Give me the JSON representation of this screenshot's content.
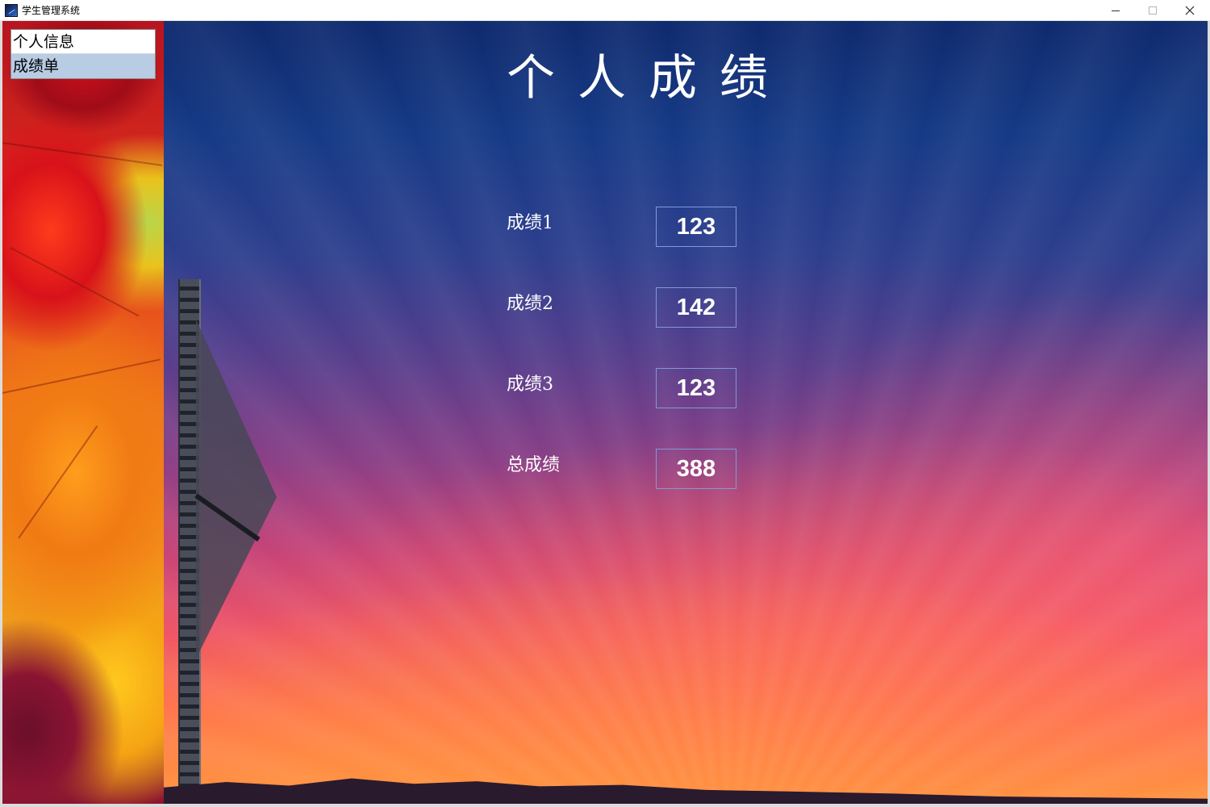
{
  "window": {
    "title": "学生管理系统",
    "close_glyph": "✕"
  },
  "sidebar": {
    "items": [
      {
        "label": "个人信息",
        "selected": false
      },
      {
        "label": "成绩单",
        "selected": true
      }
    ]
  },
  "main": {
    "title": "个人成绩",
    "grades": [
      {
        "label": "成绩1",
        "value": "123"
      },
      {
        "label": "成绩2",
        "value": "142"
      },
      {
        "label": "成绩3",
        "value": "123"
      },
      {
        "label": "总成绩",
        "value": "388"
      }
    ]
  },
  "icons": {
    "app": "app-icon",
    "minimize": "minimize-icon",
    "maximize": "maximize-icon",
    "close": "close-icon"
  },
  "colors": {
    "nav_selected": "#b8cce4",
    "field_border": "#7f9ad8",
    "text_light": "#ffffff"
  }
}
